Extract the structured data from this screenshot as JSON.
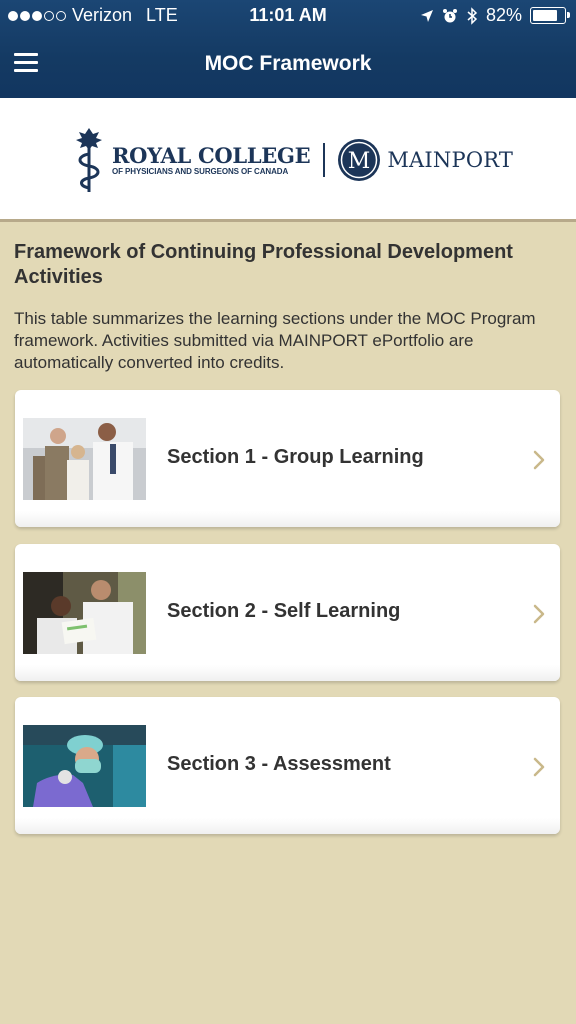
{
  "status_bar": {
    "carrier": "Verizon",
    "network": "LTE",
    "time": "11:01 AM",
    "battery_text": "82%",
    "battery_level": 0.82,
    "signal_bars_on": 3,
    "signal_bars_total": 5
  },
  "nav": {
    "title": "MOC Framework",
    "menu_icon": "hamburger-icon"
  },
  "logos": {
    "royal_college_name": "ROYAL COLLEGE",
    "royal_college_sub": "OF PHYSICIANS AND SURGEONS OF CANADA",
    "mainport_letter": "M",
    "mainport_name": "MAINPORT"
  },
  "content": {
    "heading": "Framework of Continuing Professional Development Activities",
    "intro": "This table summarizes the learning sections under the MOC Program framework. Activities submitted via MAINPORT ePortfolio are automatically converted into credits."
  },
  "sections": [
    {
      "label": "Section 1 - Group Learning"
    },
    {
      "label": "Section 2 - Self Learning"
    },
    {
      "label": "Section 3 - Assessment"
    }
  ],
  "colors": {
    "nav_bar": "#143a63",
    "page_background": "#e2d9b6",
    "logo_blue": "#1c3558",
    "chevron": "#c9b88a"
  }
}
